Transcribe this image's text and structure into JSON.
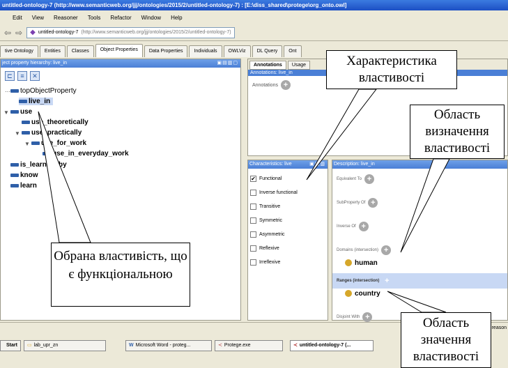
{
  "window": {
    "title": "untitled-ontology-7 (http://www.semanticweb.org/jjj/ontologies/2015/2/untitled-ontology-7) : [E:\\diss_shared\\protege\\org_onto.owl]"
  },
  "menu": [
    "Edit",
    "View",
    "Reasoner",
    "Tools",
    "Refactor",
    "Window",
    "Help"
  ],
  "toolbar": {
    "ontology_name": "untitled-ontology-7",
    "ontology_uri": "(http://www.semanticweb.org/jjj/ontologies/2015/2/untitled-ontology-7)"
  },
  "tabs": [
    "tive Ontology",
    "Entities",
    "Classes",
    "Object Properties",
    "Data Properties",
    "Individuals",
    "OWLViz",
    "DL Query",
    "Ont"
  ],
  "left_pane": {
    "header": "ject property hierarchy: live_in",
    "tree": [
      "topObjectProperty",
      "live_in",
      "use",
      "use_theoretically",
      "use_practically",
      "use_for_work",
      "use_in_everyday_work",
      "is_learned_by",
      "know",
      "learn"
    ]
  },
  "annotations": {
    "tabs": [
      "Annotations",
      "Usage"
    ],
    "header": "Annotations: live_in",
    "label": "Annotations"
  },
  "characteristics": {
    "header": "Characteristics: live",
    "items": [
      {
        "label": "Functional",
        "checked": true
      },
      {
        "label": "Inverse functional",
        "checked": false
      },
      {
        "label": "Transitive",
        "checked": false
      },
      {
        "label": "Symmetric",
        "checked": false
      },
      {
        "label": "Asymmetric",
        "checked": false
      },
      {
        "label": "Reflexive",
        "checked": false
      },
      {
        "label": "Irreflexive",
        "checked": false
      }
    ]
  },
  "description": {
    "header": "Description: live_in",
    "equivalent": "Equivalent To",
    "subproperty": "SubProperty Of",
    "inverse": "Inverse Of",
    "domains": "Domains (intersection)",
    "domain_value": "human",
    "ranges": "Ranges (intersection)",
    "range_value": "country",
    "disjoint": "Disjoint With"
  },
  "status": {
    "right_text": "reason"
  },
  "taskbar": [
    {
      "label": "start",
      "icon": "windows-start-icon"
    },
    {
      "label": "lab_upr_zn",
      "icon": "folder-icon"
    },
    {
      "label": "Microsoft Word - proteg...",
      "icon": "word-icon"
    },
    {
      "label": "Protege.exe",
      "icon": "protege-icon"
    },
    {
      "label": "untitled-ontology-7 (...",
      "icon": "protege-icon"
    }
  ],
  "callouts": {
    "property_characteristic": "Характеристика властивості",
    "domain": "Область визначення властивості",
    "selected_property": "Обрана властивість, що є функціональною",
    "range": "Область значення властивості"
  }
}
